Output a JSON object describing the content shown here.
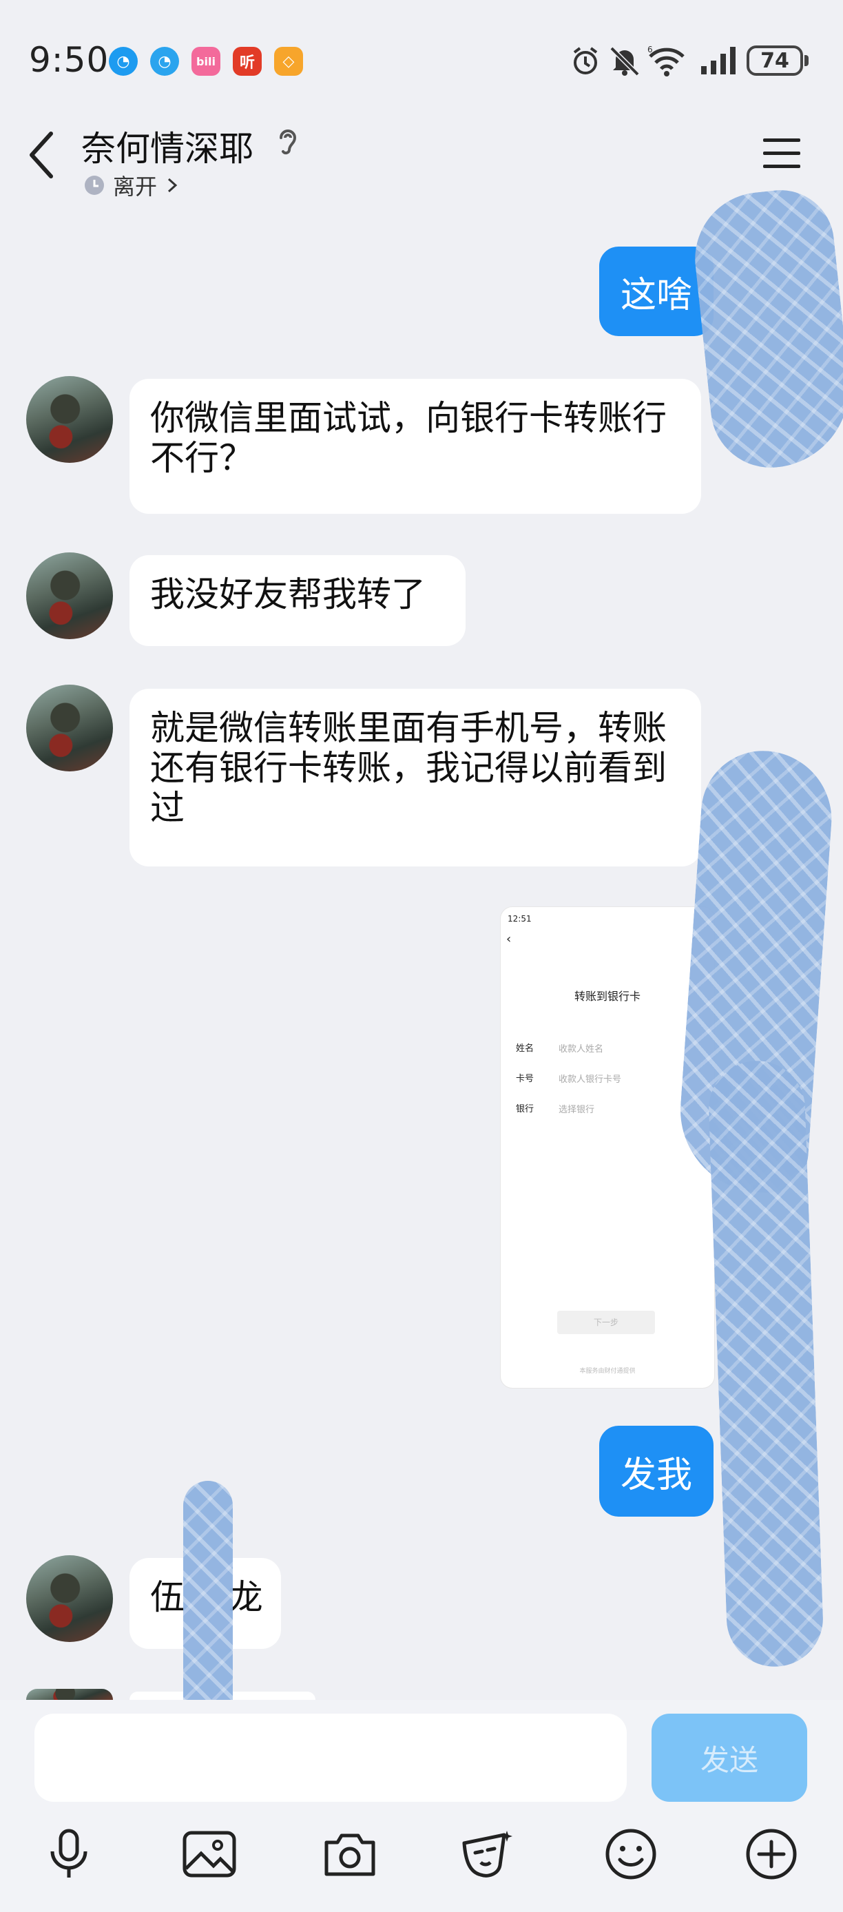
{
  "status_bar": {
    "time": "9:50",
    "battery": "74",
    "apps": [
      {
        "name": "browser-icon",
        "color": "#1d9bf0",
        "glyph": "◔"
      },
      {
        "name": "browser-icon-2",
        "color": "#2aa4ee",
        "glyph": "◔"
      },
      {
        "name": "bilibili-icon",
        "color": "#f36a9b",
        "glyph": "bili"
      },
      {
        "name": "listen-icon",
        "color": "#e23b27",
        "glyph": "听"
      },
      {
        "name": "app-icon",
        "color": "#f7a52b",
        "glyph": "◇"
      }
    ]
  },
  "header": {
    "title": "奈何情深耶",
    "status": "离开"
  },
  "messages": {
    "out_1": "这啥",
    "in_1": "你微信里面试试，向银行卡转账行不行？",
    "in_2": "我没好友帮我转了",
    "in_3": "就是微信转账里面有手机号，转账还有银行卡转账，我记得以前看到过",
    "out_2": "发我",
    "in_4": "伍    龙"
  },
  "image_message": {
    "time": "12:51",
    "page_title": "转账到银行卡",
    "fields": [
      {
        "label": "姓名",
        "placeholder": "收款人姓名"
      },
      {
        "label": "卡号",
        "placeholder": "收款人银行卡号"
      },
      {
        "label": "银行",
        "placeholder": "选择银行"
      }
    ],
    "next_button": "下一步",
    "footer": "本服务由财付通提供"
  },
  "input_bar": {
    "placeholder": "",
    "send_label": "发送"
  },
  "colors": {
    "accent": "#1e90f5",
    "send_disabled": "#7cc3f7",
    "background": "#eff0f4"
  }
}
